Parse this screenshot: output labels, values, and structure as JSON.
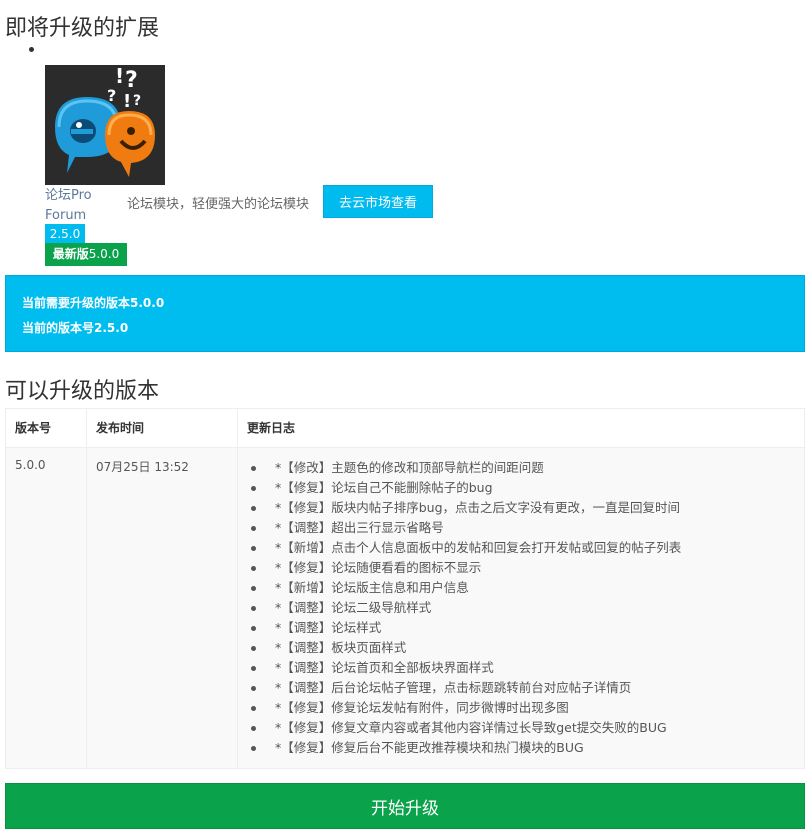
{
  "upcoming": {
    "title": "即将升级的扩展",
    "plugin": {
      "icon": "forum-chat-bubbles-icon",
      "name_lines": [
        "论坛Pro",
        "Forum"
      ],
      "description": "论坛模块，轻便强大的论坛模块",
      "market_button": "去云市场查看",
      "current_version": "2.5.0",
      "latest_label": "最新版",
      "latest_version": "5.0.0"
    }
  },
  "info": {
    "need_label": "当前需要升级的版本",
    "need_version": "5.0.0",
    "current_label": "当前的版本号",
    "current_version": "2.5.0"
  },
  "versions": {
    "title": "可以升级的版本",
    "columns": [
      "版本号",
      "发布时间",
      "更新日志"
    ],
    "rows": [
      {
        "version": "5.0.0",
        "date": "07月25日 13:52",
        "log": [
          "*【修改】主题色的修改和顶部导航栏的间距问题",
          "*【修复】论坛自己不能删除帖子的bug",
          "*【修复】版块内帖子排序bug，点击之后文字没有更改，一直是回复时间",
          "*【调整】超出三行显示省略号",
          "*【新增】点击个人信息面板中的发帖和回复会打开发帖或回复的帖子列表",
          "*【修复】论坛随便看看的图标不显示",
          "*【新增】论坛版主信息和用户信息",
          "*【调整】论坛二级导航样式",
          "*【调整】论坛样式",
          "*【调整】板块页面样式",
          "*【调整】论坛首页和全部板块界面样式",
          "*【调整】后台论坛帖子管理，点击标题跳转前台对应帖子详情页",
          "*【修复】修复论坛发帖有附件，同步微博时出现多图",
          "*【修复】修复文章内容或者其他内容详情过长导致get提交失败的BUG",
          "*【修复】修复后台不能更改推荐模块和热门模块的BUG"
        ]
      }
    ]
  },
  "start_button": "开始升级",
  "colors": {
    "accent_blue": "#00bdef",
    "accent_green": "#0aa24a"
  }
}
